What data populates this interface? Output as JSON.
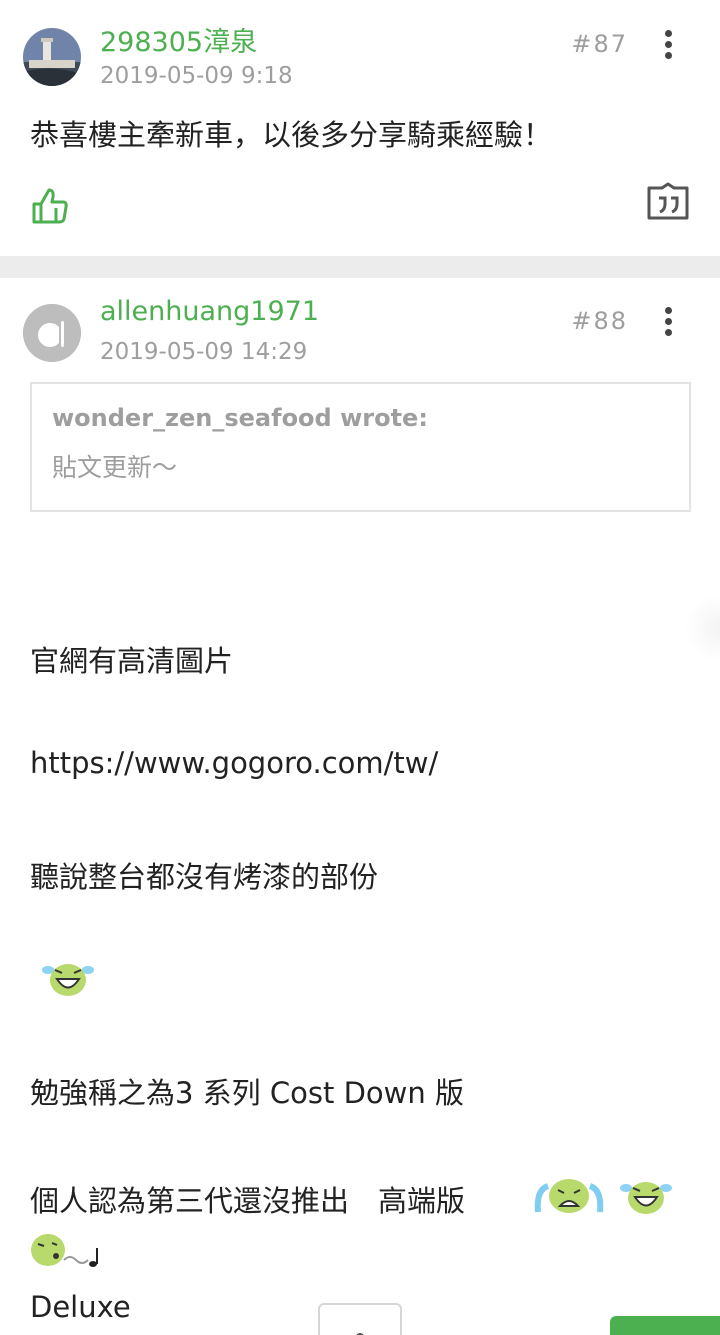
{
  "posts": [
    {
      "username": "298305漳泉",
      "date": "2019-05-09 9:18",
      "floor": "#87",
      "text": "恭喜樓主牽新車，以後多分享騎乘經驗！"
    },
    {
      "username": "allenhuang1971",
      "date": "2019-05-09 14:29",
      "floor": "#88",
      "quote": {
        "author": "wonder_zen_seafood wrote:",
        "text": "貼文更新～"
      },
      "lines": [
        "官網有高清圖片",
        "https://www.gogoro.com/tw/",
        "聽說整台都沒有烤漆的部份",
        "勉強稱之為3 系列 Cost Down 版",
        "個人認為第三代還沒推出　高端版",
        "Deluxe"
      ]
    }
  ],
  "icons": {
    "like": "thumbs-up-icon",
    "quote": "quote-reply-icon",
    "more": "more-vertical-icon",
    "emoji_laugh": "laughing-face-emoji",
    "emoji_cry": "crying-face-emoji",
    "emoji_whistle": "whistling-face-emoji"
  },
  "colors": {
    "accent": "#4caf50",
    "muted": "#9e9e9e",
    "divider": "#ececec"
  }
}
